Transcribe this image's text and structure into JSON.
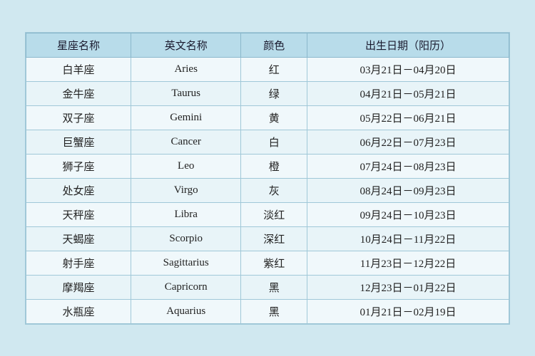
{
  "table": {
    "headers": [
      "星座名称",
      "英文名称",
      "颜色",
      "出生日期（阳历）"
    ],
    "rows": [
      {
        "chinese": "白羊座",
        "english": "Aries",
        "color": "红",
        "date": "03月21日－04月20日"
      },
      {
        "chinese": "金牛座",
        "english": "Taurus",
        "color": "绿",
        "date": "04月21日－05月21日"
      },
      {
        "chinese": "双子座",
        "english": "Gemini",
        "color": "黄",
        "date": "05月22日－06月21日"
      },
      {
        "chinese": "巨蟹座",
        "english": "Cancer",
        "color": "白",
        "date": "06月22日－07月23日"
      },
      {
        "chinese": "狮子座",
        "english": "Leo",
        "color": "橙",
        "date": "07月24日－08月23日"
      },
      {
        "chinese": "处女座",
        "english": "Virgo",
        "color": "灰",
        "date": "08月24日－09月23日"
      },
      {
        "chinese": "天秤座",
        "english": "Libra",
        "color": "淡红",
        "date": "09月24日－10月23日"
      },
      {
        "chinese": "天蝎座",
        "english": "Scorpio",
        "color": "深红",
        "date": "10月24日－11月22日"
      },
      {
        "chinese": "射手座",
        "english": "Sagittarius",
        "color": "紫红",
        "date": "11月23日－12月22日"
      },
      {
        "chinese": "摩羯座",
        "english": "Capricorn",
        "color": "黑",
        "date": "12月23日－01月22日"
      },
      {
        "chinese": "水瓶座",
        "english": "Aquarius",
        "color": "黑",
        "date": "01月21日－02月19日"
      }
    ]
  }
}
